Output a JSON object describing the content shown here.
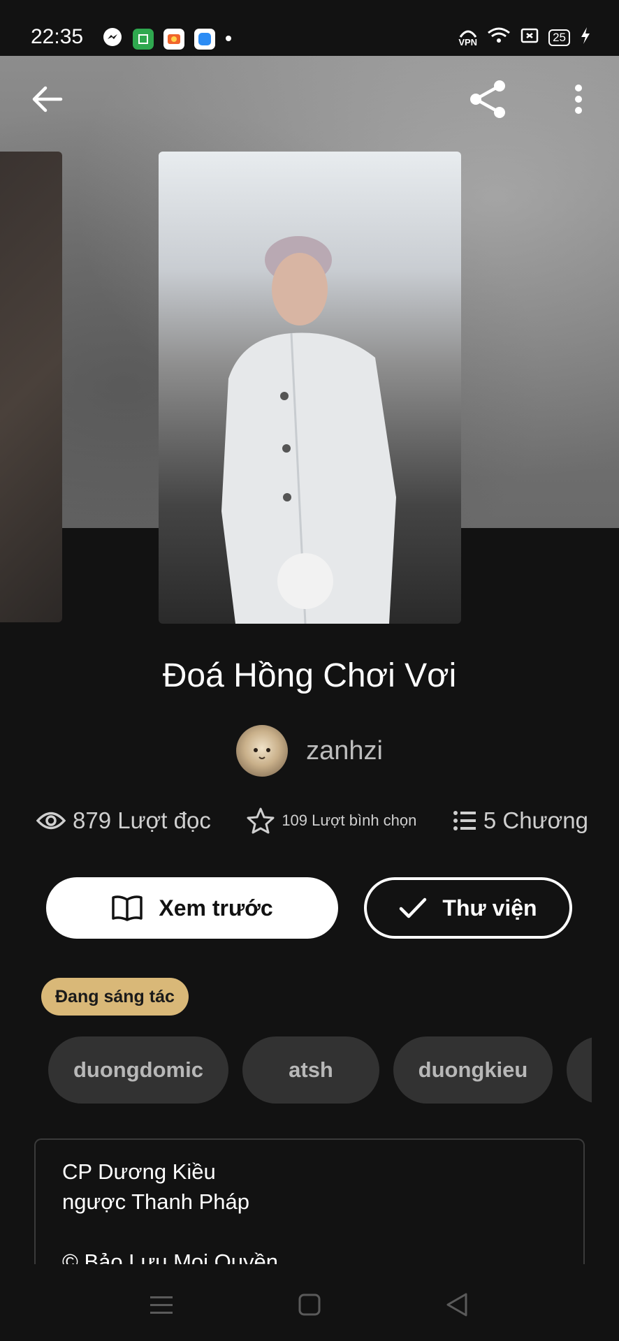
{
  "status_bar": {
    "time": "22:35",
    "vpn_label": "VPN",
    "battery": "25"
  },
  "book": {
    "title": "Đoá Hồng Chơi Vơi",
    "author": "zanhzi"
  },
  "stats": {
    "reads": "879 Lượt đọc",
    "votes": "109 Lượt bình chọn",
    "chapters": "5 Chương"
  },
  "actions": {
    "preview_label": "Xem trước",
    "library_label": "Thư viện"
  },
  "status_badge": "Đang sáng tác",
  "tags": [
    "duongdomic",
    "atsh",
    "duongkieu"
  ],
  "description": {
    "lines": [
      "CP Dương Kiều",
      "ngược Thanh Pháp",
      "",
      "© Bảo Lưu Mọi Quyền"
    ]
  },
  "colors": {
    "background": "#121212",
    "badge": "#d9b878",
    "tag_bg": "#323232",
    "button_fill": "#ffffff"
  },
  "icons": [
    "back-arrow-icon",
    "share-icon",
    "more-vertical-icon",
    "eye-icon",
    "star-icon",
    "list-icon",
    "book-open-icon",
    "check-icon",
    "menu-icon",
    "home-square-icon",
    "back-triangle-icon"
  ]
}
